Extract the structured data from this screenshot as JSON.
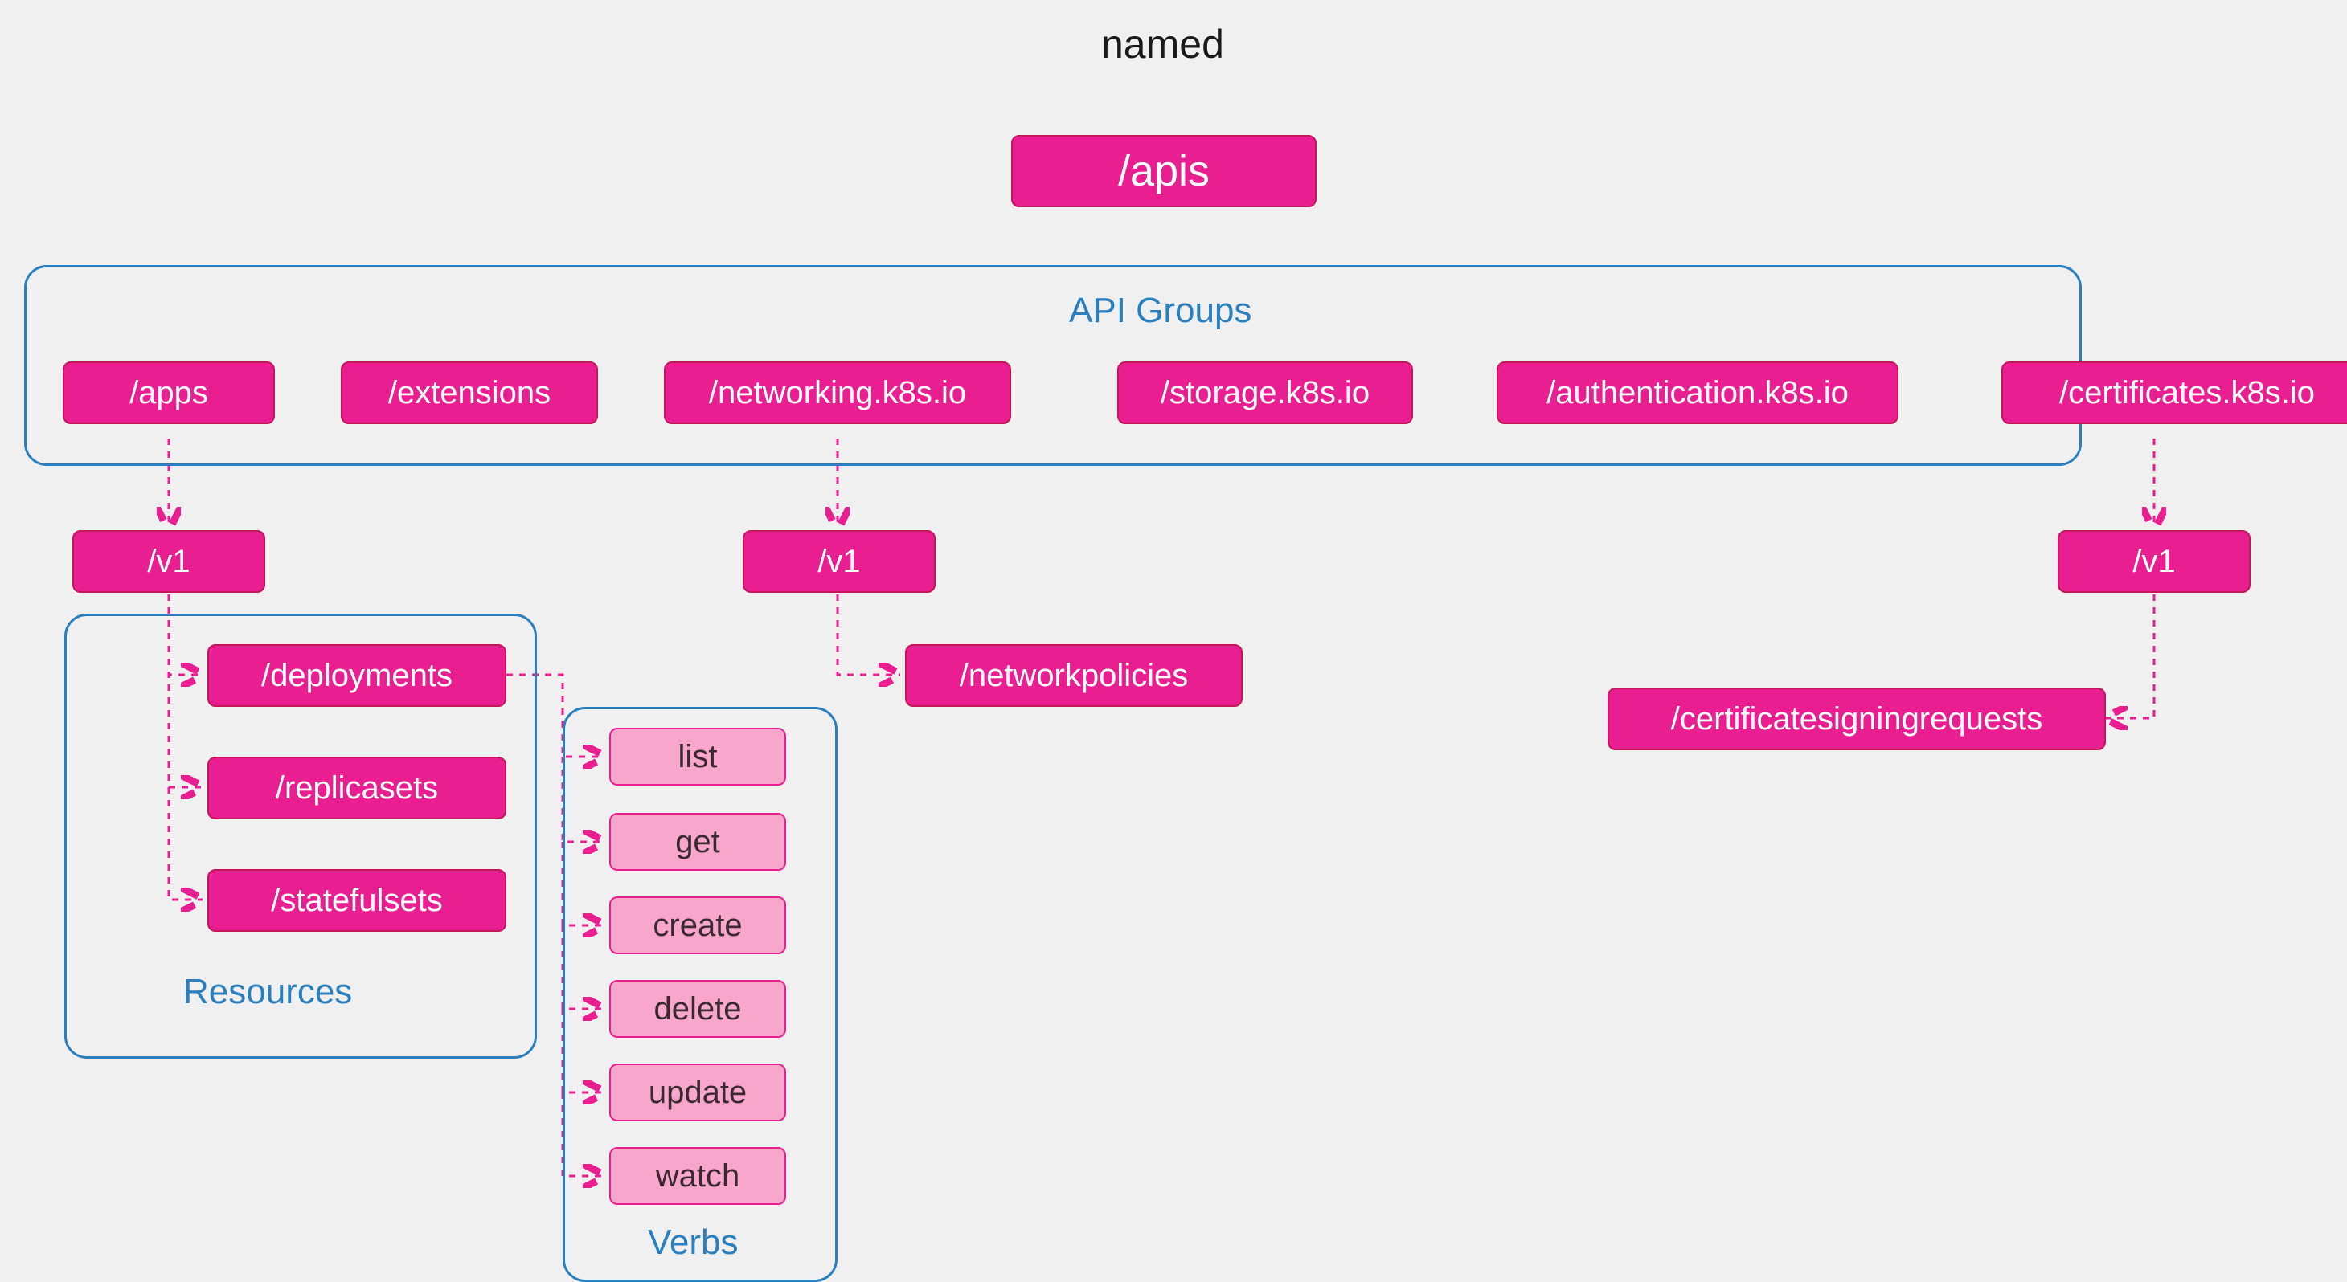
{
  "title": "named",
  "root": "/apis",
  "groupBoxes": {
    "apiGroups": "API Groups",
    "resources": "Resources",
    "verbs": "Verbs"
  },
  "apiGroups": [
    "/apps",
    "/extensions",
    "/networking.k8s.io",
    "/storage.k8s.io",
    "/authentication.k8s.io",
    "/certificates.k8s.io"
  ],
  "versions": {
    "apps": "/v1",
    "networking": "/v1",
    "certificates": "/v1"
  },
  "resources": {
    "apps": [
      "/deployments",
      "/replicasets",
      "/statefulsets"
    ],
    "networking": "/networkpolicies",
    "certificates": "/certificatesigningrequests"
  },
  "verbs": [
    "list",
    "get",
    "create",
    "delete",
    "update",
    "watch"
  ]
}
